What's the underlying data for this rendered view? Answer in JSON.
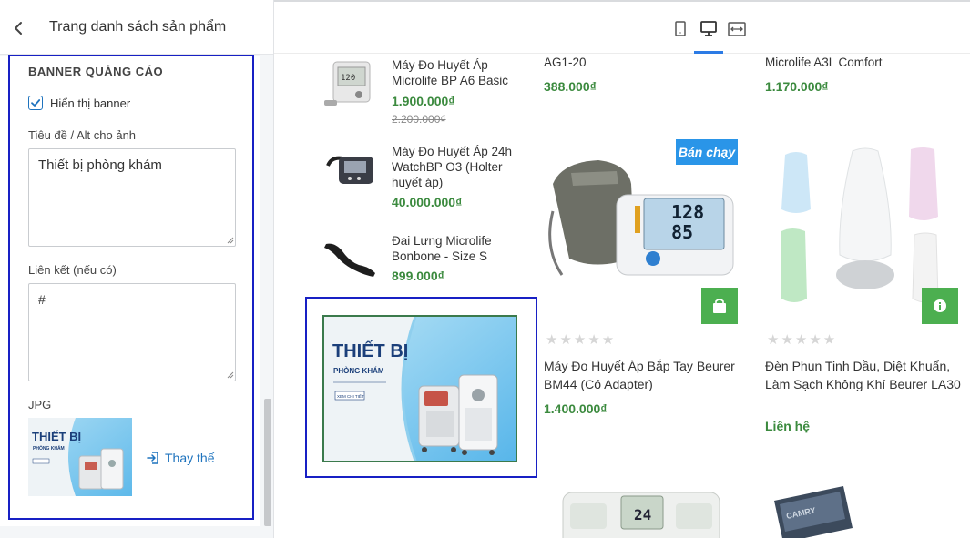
{
  "panel": {
    "title": "Trang danh sách sản phẩm",
    "section_title": "BANNER QUẢNG CÁO",
    "show_banner_label": "Hiển thị banner",
    "show_banner_checked": true,
    "alt_label": "Tiêu đề / Alt cho ảnh",
    "alt_value": "Thiết bị phòng khám",
    "link_label": "Liên kết (nếu có)",
    "link_value": "#",
    "file_type": "JPG",
    "replace_label": "Thay thế"
  },
  "toolbar": {
    "devices": [
      "mobile-icon",
      "desktop-icon",
      "fullwidth-icon"
    ],
    "active_device": "desktop",
    "accent_color": "#2c7be5"
  },
  "list_products": [
    {
      "name": "Máy Đo Huyết Áp Microlife BP A6 Basic",
      "price": "1.900.000₫",
      "old_price": "2.200.000₫"
    },
    {
      "name": "Máy Đo Huyết Áp 24h WatchBP O3 (Holter huyết áp)",
      "price": "40.000.000₫"
    },
    {
      "name": "Đai Lưng Microlife Bonbone - Size S",
      "price": "899.000₫"
    }
  ],
  "banner": {
    "line1": "THIẾT BỊ",
    "line2": "PHÒNG KHÁM",
    "cta": "XEM CHI TIẾT"
  },
  "grid_top": [
    {
      "name_tail": "AG1-20",
      "price": "388.000₫"
    },
    {
      "name_tail": "Microlife A3L Comfort",
      "price": "1.170.000₫"
    }
  ],
  "grid_products": [
    {
      "badge": "Bán chạy",
      "name": "Máy Đo Huyết Áp Bắp Tay Beurer BM44 (Có Adapter)",
      "price": "1.400.000₫",
      "rating": 0
    },
    {
      "name": "Đèn Phun Tinh Dầu, Diệt Khuẩn, Làm Sạch Không Khí Beurer LA30",
      "price": "Liên hệ",
      "rating": 0
    }
  ],
  "colors": {
    "price_green": "#3b8a3e",
    "button_green": "#4caf50",
    "badge_blue": "#2a95e8",
    "selection_blue": "#1820c4"
  }
}
